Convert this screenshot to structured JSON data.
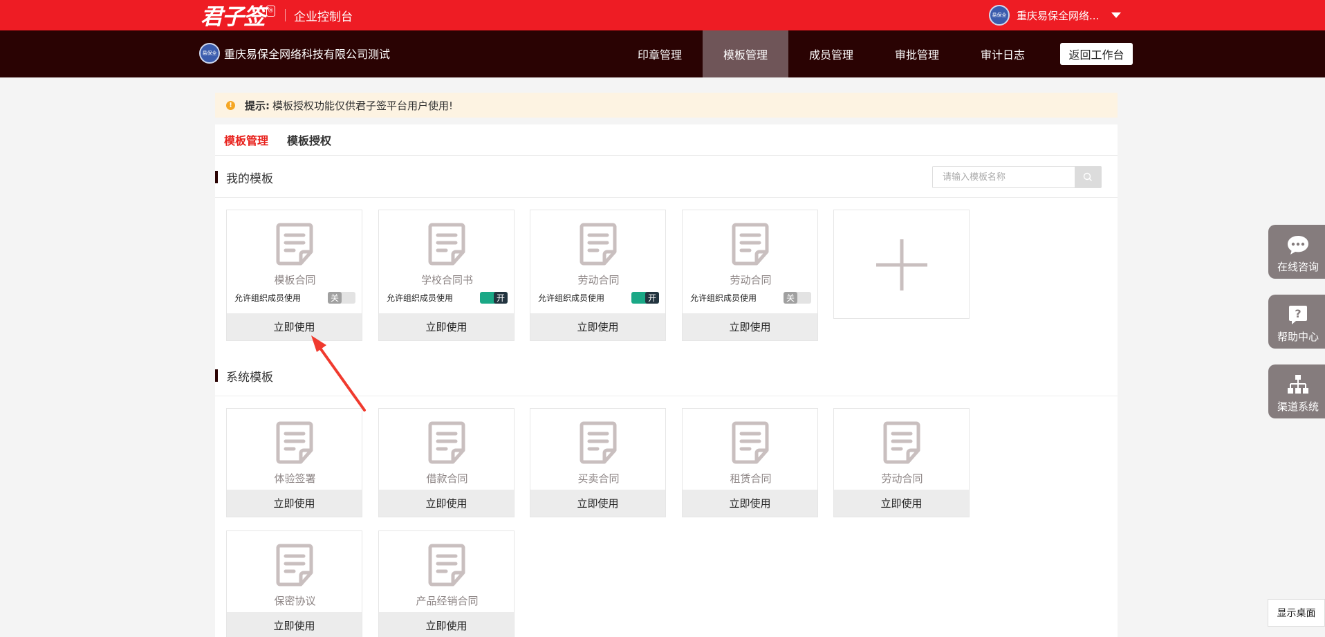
{
  "topbar": {
    "brand_logo": "君子签",
    "brand_reg": "®",
    "console_label": "企业控制台",
    "user_name": "重庆易保全网络...",
    "avatar_text": "易保全"
  },
  "navbar": {
    "company_name": "重庆易保全网络科技有限公司测试",
    "items": [
      {
        "label": "印章管理"
      },
      {
        "label": "模板管理"
      },
      {
        "label": "成员管理"
      },
      {
        "label": "审批管理"
      },
      {
        "label": "审计日志"
      }
    ],
    "active_index": 1,
    "back_label": "返回工作台"
  },
  "notice": {
    "label": "提示:",
    "text": "模板授权功能仅供君子签平台用户使用!"
  },
  "tabs": [
    {
      "label": "模板管理"
    },
    {
      "label": "模板授权"
    }
  ],
  "my_templates": {
    "title": "我的模板",
    "search_placeholder": "请输入模板名称",
    "permission_label": "允许组织成员使用",
    "toggle_on_text": "开",
    "toggle_off_text": "关",
    "use_label": "立即使用",
    "cards": [
      {
        "name": "模板合同",
        "allow_members": false
      },
      {
        "name": "学校合同书",
        "allow_members": true
      },
      {
        "name": "劳动合同",
        "allow_members": true
      },
      {
        "name": "劳动合同",
        "allow_members": false
      }
    ]
  },
  "system_templates": {
    "title": "系统模板",
    "use_label": "立即使用",
    "cards": [
      {
        "name": "体验签署"
      },
      {
        "name": "借款合同"
      },
      {
        "name": "买卖合同"
      },
      {
        "name": "租赁合同"
      },
      {
        "name": "劳动合同"
      },
      {
        "name": "保密协议"
      },
      {
        "name": "产品经销合同"
      }
    ]
  },
  "widgets": {
    "online_consult": "在线咨询",
    "help_center": "帮助中心",
    "channel_system": "渠道系统",
    "show_desktop": "显示桌面"
  },
  "colors": {
    "brand_red": "#ee1c24",
    "nav_dark": "#2a0303",
    "active_tab_red": "#e8221d",
    "toggle_on": "#1aa886",
    "annotation_arrow": "#f03a2e"
  }
}
